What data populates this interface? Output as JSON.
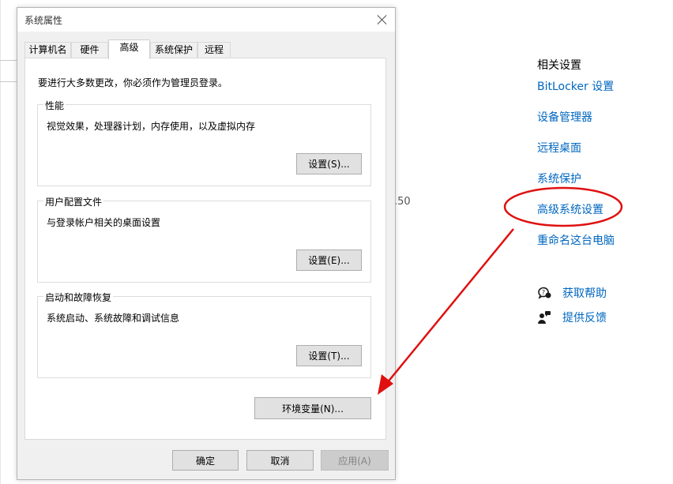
{
  "background": {
    "partial_value": ".50"
  },
  "dialog": {
    "title": "系统属性",
    "tabs": [
      {
        "label": "计算机名",
        "active": false
      },
      {
        "label": "硬件",
        "active": false
      },
      {
        "label": "高级",
        "active": true
      },
      {
        "label": "系统保护",
        "active": false
      },
      {
        "label": "远程",
        "active": false
      }
    ],
    "notice": "要进行大多数更改，你必须作为管理员登录。",
    "groups": [
      {
        "title": "性能",
        "description": "视觉效果，处理器计划，内存使用，以及虚拟内存",
        "button": "设置(S)..."
      },
      {
        "title": "用户配置文件",
        "description": "与登录帐户相关的桌面设置",
        "button": "设置(E)..."
      },
      {
        "title": "启动和故障恢复",
        "description": "系统启动、系统故障和调试信息",
        "button": "设置(T)..."
      }
    ],
    "env_button": "环境变量(N)...",
    "footer": {
      "ok": "确定",
      "cancel": "取消",
      "apply": "应用(A)"
    }
  },
  "related": {
    "heading": "相关设置",
    "links": [
      "BitLocker 设置",
      "设备管理器",
      "远程桌面",
      "系统保护",
      "高级系统设置",
      "重命名这台电脑"
    ],
    "help": {
      "get_help": "获取帮助",
      "feedback": "提供反馈"
    }
  },
  "colors": {
    "link": "#0067c0",
    "annotation": "#e01010"
  },
  "icons": {
    "close": "close-icon",
    "get_help": "chat-help-icon",
    "feedback": "feedback-person-icon"
  }
}
